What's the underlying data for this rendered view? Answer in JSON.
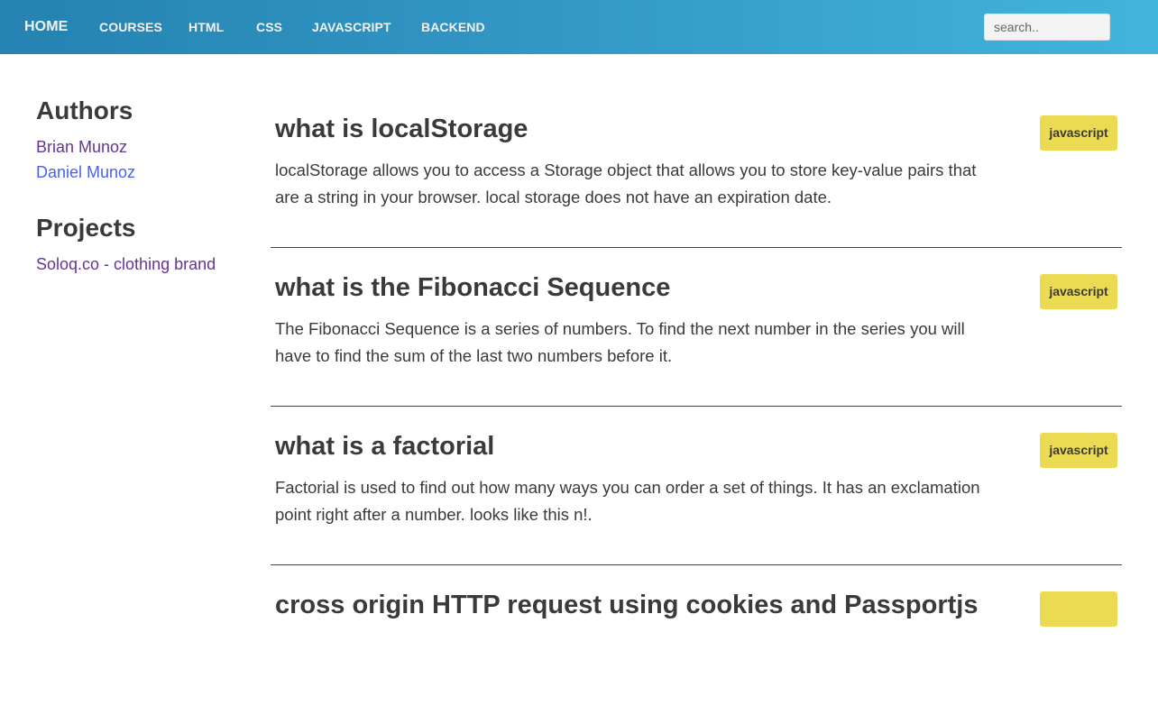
{
  "nav": {
    "items": [
      "HOME",
      "COURSES",
      "HTML",
      "CSS",
      "JAVASCRIPT",
      "BACKEND"
    ],
    "search_placeholder": "search.."
  },
  "sidebar": {
    "authors_heading": "Authors",
    "authors": [
      "Brian Munoz",
      "Daniel Munoz"
    ],
    "projects_heading": "Projects",
    "projects": [
      "Soloq.co - clothing brand"
    ],
    "colors": {
      "visited": "#663399",
      "link": "#4a63e6"
    }
  },
  "posts": [
    {
      "title": "what is localStorage",
      "body": "localStorage allows you to access a Storage object that allows you to store key-value pairs that are a string in your browser. local storage does not have an expiration date.",
      "tag": "javascript"
    },
    {
      "title": "what is the Fibonacci Sequence",
      "body": "The Fibonacci Sequence is a series of numbers. To find the next number in the series you will have to find the sum of the last two numbers before it.",
      "tag": "javascript"
    },
    {
      "title": "what is a factorial",
      "body": "Factorial is used to find out how many ways you can order a set of things. It has an exclamation point right after a number. looks like this n!.",
      "tag": "javascript"
    },
    {
      "title": "cross origin HTTP request using cookies and Passportjs",
      "body": "",
      "tag": ""
    }
  ],
  "tag_color": "#ebdb52"
}
